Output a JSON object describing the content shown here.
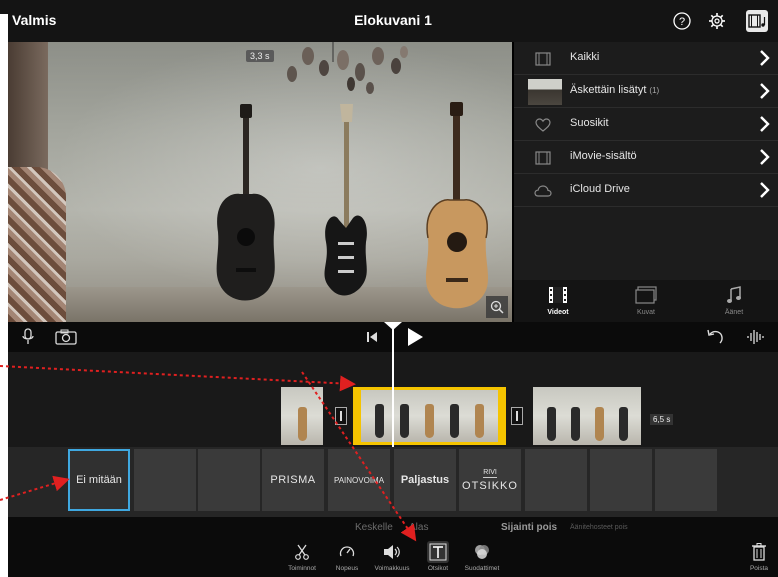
{
  "topbar": {
    "done_label": "Valmis",
    "title": "Elokuvani 1"
  },
  "viewer": {
    "duration_badge": "3,3 s"
  },
  "browser": {
    "rows": [
      {
        "label": "Kaikki",
        "icon": "film-icon"
      },
      {
        "label": "Äskettäin lisätyt",
        "count": "(1)",
        "icon": "thumbnail"
      },
      {
        "label": "Suosikit",
        "icon": "heart-icon"
      },
      {
        "label": "iMovie-sisältö",
        "icon": "film-icon"
      },
      {
        "label": "iCloud Drive",
        "icon": "cloud-icon"
      }
    ],
    "tabs": [
      {
        "label": "Videot",
        "active": true
      },
      {
        "label": "Kuvat",
        "active": false
      },
      {
        "label": "Äänet",
        "active": false
      }
    ]
  },
  "timeline": {
    "clip_duration": "6,5 s"
  },
  "title_styles": {
    "none_label": "Ei mitään",
    "prisma_label": "PRISMA",
    "painovoima_label": "PAINOVOIMA",
    "paljastus_label": "Paljastus",
    "rivi_small": "RIVI",
    "rivi_big": "OTSIKKO"
  },
  "positions": {
    "center": "Keskelle",
    "down": "Alas",
    "location_off": "Sijainti pois",
    "sound_effects_off": "Äänitehosteet pois"
  },
  "toolbar": {
    "actions": "Toiminnot",
    "speed": "Nopeus",
    "volume": "Voimakkuus",
    "titles": "Otsikot",
    "filters": "Suodattimet",
    "delete": "Poista"
  },
  "colors": {
    "selection_yellow": "#f5c400",
    "selection_blue": "#3fa8e0",
    "annotation_red": "#e02020"
  }
}
